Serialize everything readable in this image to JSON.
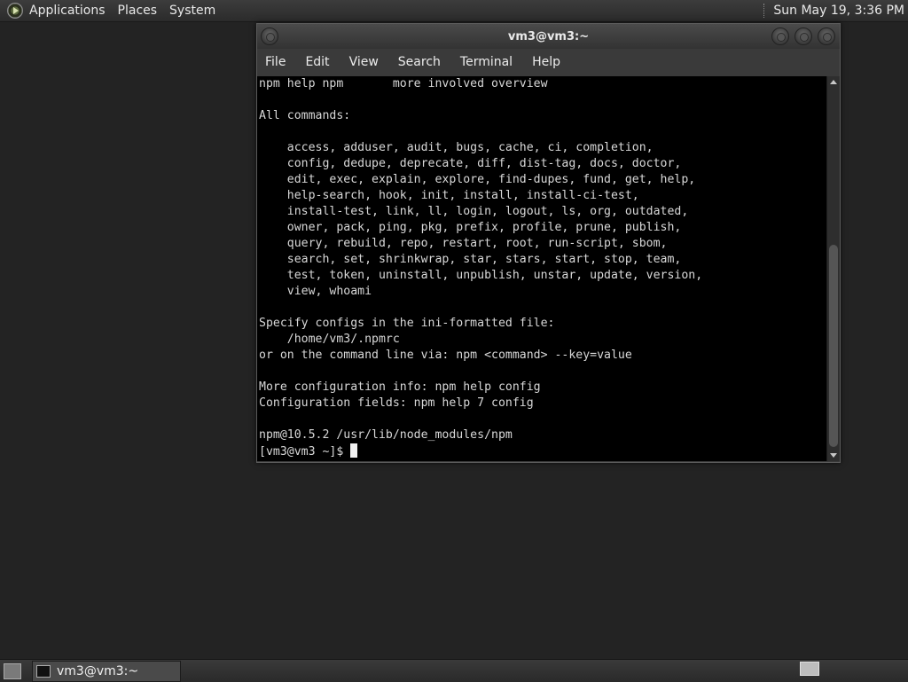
{
  "top_panel": {
    "menus": [
      "Applications",
      "Places",
      "System"
    ],
    "clock": "Sun May 19,  3:36 PM"
  },
  "window": {
    "title": "vm3@vm3:~",
    "menubar": [
      "File",
      "Edit",
      "View",
      "Search",
      "Terminal",
      "Help"
    ]
  },
  "terminal": {
    "lines": [
      "npm help npm       more involved overview",
      "",
      "All commands:",
      "",
      "    access, adduser, audit, bugs, cache, ci, completion,",
      "    config, dedupe, deprecate, diff, dist-tag, docs, doctor,",
      "    edit, exec, explain, explore, find-dupes, fund, get, help,",
      "    help-search, hook, init, install, install-ci-test,",
      "    install-test, link, ll, login, logout, ls, org, outdated,",
      "    owner, pack, ping, pkg, prefix, profile, prune, publish,",
      "    query, rebuild, repo, restart, root, run-script, sbom,",
      "    search, set, shrinkwrap, star, stars, start, stop, team,",
      "    test, token, uninstall, unpublish, unstar, update, version,",
      "    view, whoami",
      "",
      "Specify configs in the ini-formatted file:",
      "    /home/vm3/.npmrc",
      "or on the command line via: npm <command> --key=value",
      "",
      "More configuration info: npm help config",
      "Configuration fields: npm help 7 config",
      "",
      "npm@10.5.2 /usr/lib/node_modules/npm"
    ],
    "prompt": "[vm3@vm3 ~]$ "
  },
  "bottom_panel": {
    "task_label": "vm3@vm3:~"
  }
}
